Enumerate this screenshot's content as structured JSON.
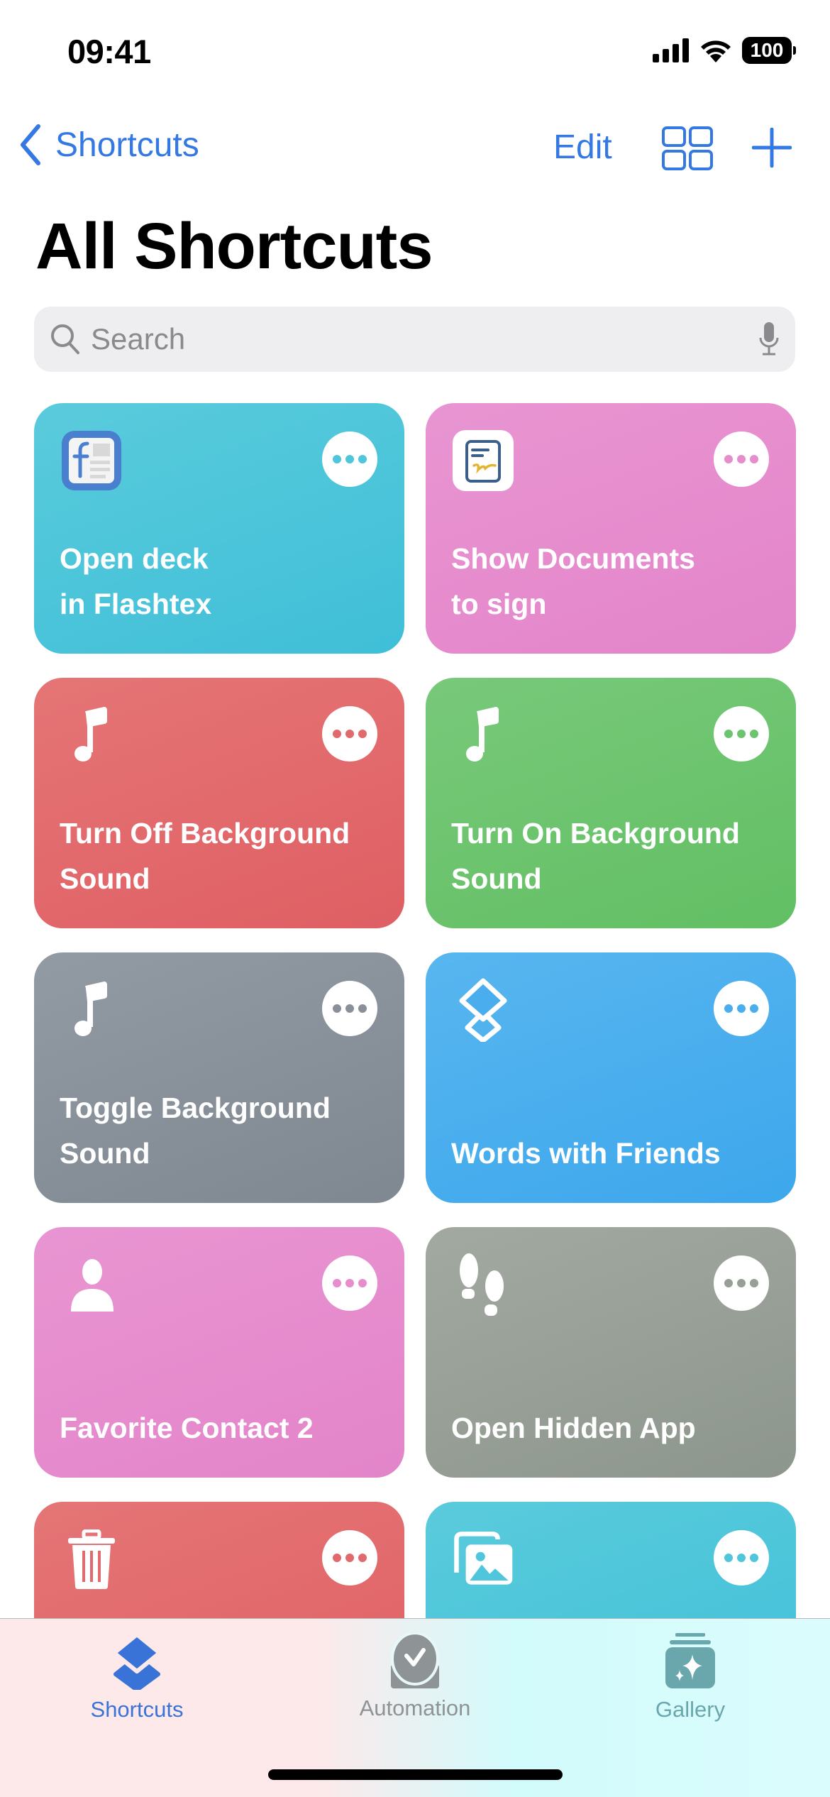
{
  "status_bar": {
    "time": "09:41",
    "battery": "100"
  },
  "nav": {
    "back_label": "Shortcuts",
    "edit_label": "Edit"
  },
  "page_title": "All Shortcuts",
  "search": {
    "placeholder": "Search",
    "value": ""
  },
  "shortcuts": [
    {
      "title": "Open deck\nin Flashtex",
      "icon": "flashtex-app-icon",
      "color": "#4fc6db"
    },
    {
      "title": "Show Documents\nto sign",
      "icon": "document-sign-app-icon",
      "color": "#e68dce"
    },
    {
      "title": "Turn Off Background\nSound",
      "icon": "music-note-icon",
      "color": "#e16a6c"
    },
    {
      "title": "Turn On Background\nSound",
      "icon": "music-note-icon",
      "color": "#6dc46e"
    },
    {
      "title": "Toggle Background\nSound",
      "icon": "music-note-icon",
      "color": "#89909a"
    },
    {
      "title": "Words with Friends",
      "icon": "shortcuts-layers-icon",
      "color": "#4aaeee"
    },
    {
      "title": "Favorite Contact 2",
      "icon": "person-icon",
      "color": "#e68dce"
    },
    {
      "title": "Open Hidden App",
      "icon": "footprints-icon",
      "color": "#979f96"
    },
    {
      "title": "",
      "icon": "trash-icon",
      "color": "#e16a6c"
    },
    {
      "title": "",
      "icon": "photos-icon",
      "color": "#4fc6db"
    }
  ],
  "tabs": [
    {
      "label": "Shortcuts",
      "active": true,
      "color": "#3a73d8"
    },
    {
      "label": "Automation",
      "active": false,
      "color": "#8e9496"
    },
    {
      "label": "Gallery",
      "active": false,
      "color": "#6aa7ad"
    }
  ]
}
